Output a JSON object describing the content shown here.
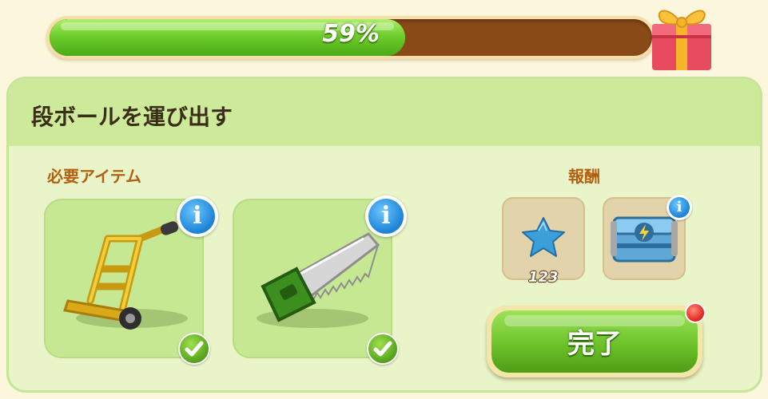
{
  "progress": {
    "percent_text": "59%",
    "fraction": 0.59
  },
  "task": {
    "title": "段ボールを運び出す",
    "required_label": "必要アイテム",
    "reward_label": "報酬",
    "required_items": [
      {
        "icon": "hand-truck-icon",
        "status": "owned"
      },
      {
        "icon": "saw-icon",
        "status": "owned"
      }
    ],
    "rewards": [
      {
        "icon": "blue-star-icon",
        "count": "123"
      },
      {
        "icon": "energy-chest-icon",
        "count": ""
      }
    ],
    "complete_button": "完了"
  },
  "colors": {
    "accent_green": "#6cc22a",
    "progress_bg": "#8a4a18",
    "label_brown": "#b35f12"
  }
}
